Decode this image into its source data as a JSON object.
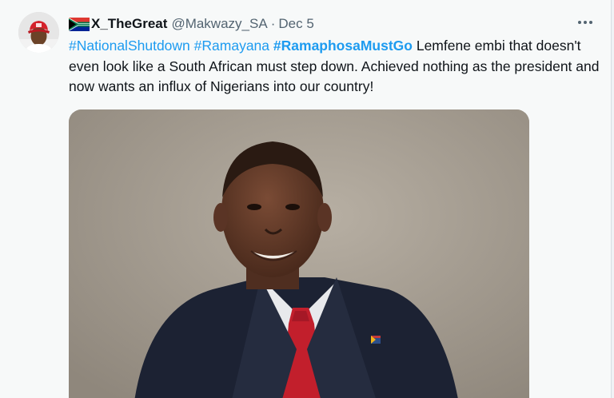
{
  "tweet": {
    "author": {
      "display_name": "X_TheGreat",
      "handle": "@Makwazy_SA",
      "flag_icon": "south-africa-flag-icon"
    },
    "separator": "·",
    "date": "Dec 5",
    "more_icon": "more-horizontal-icon",
    "hashtags": [
      "#NationalShutdown",
      "#Ramayana",
      "#RamaphosaMustGo"
    ],
    "body_text": "Lemfene embi that doesn't even look like a South African must step down. Achieved nothing as the president and now wants an influx of Nigerians into our country!",
    "media_description_icon": "portrait-photo"
  },
  "colors": {
    "link": "#1d9bf0",
    "text": "#0f1419",
    "secondary": "#536471",
    "background": "#f7f9f9"
  }
}
